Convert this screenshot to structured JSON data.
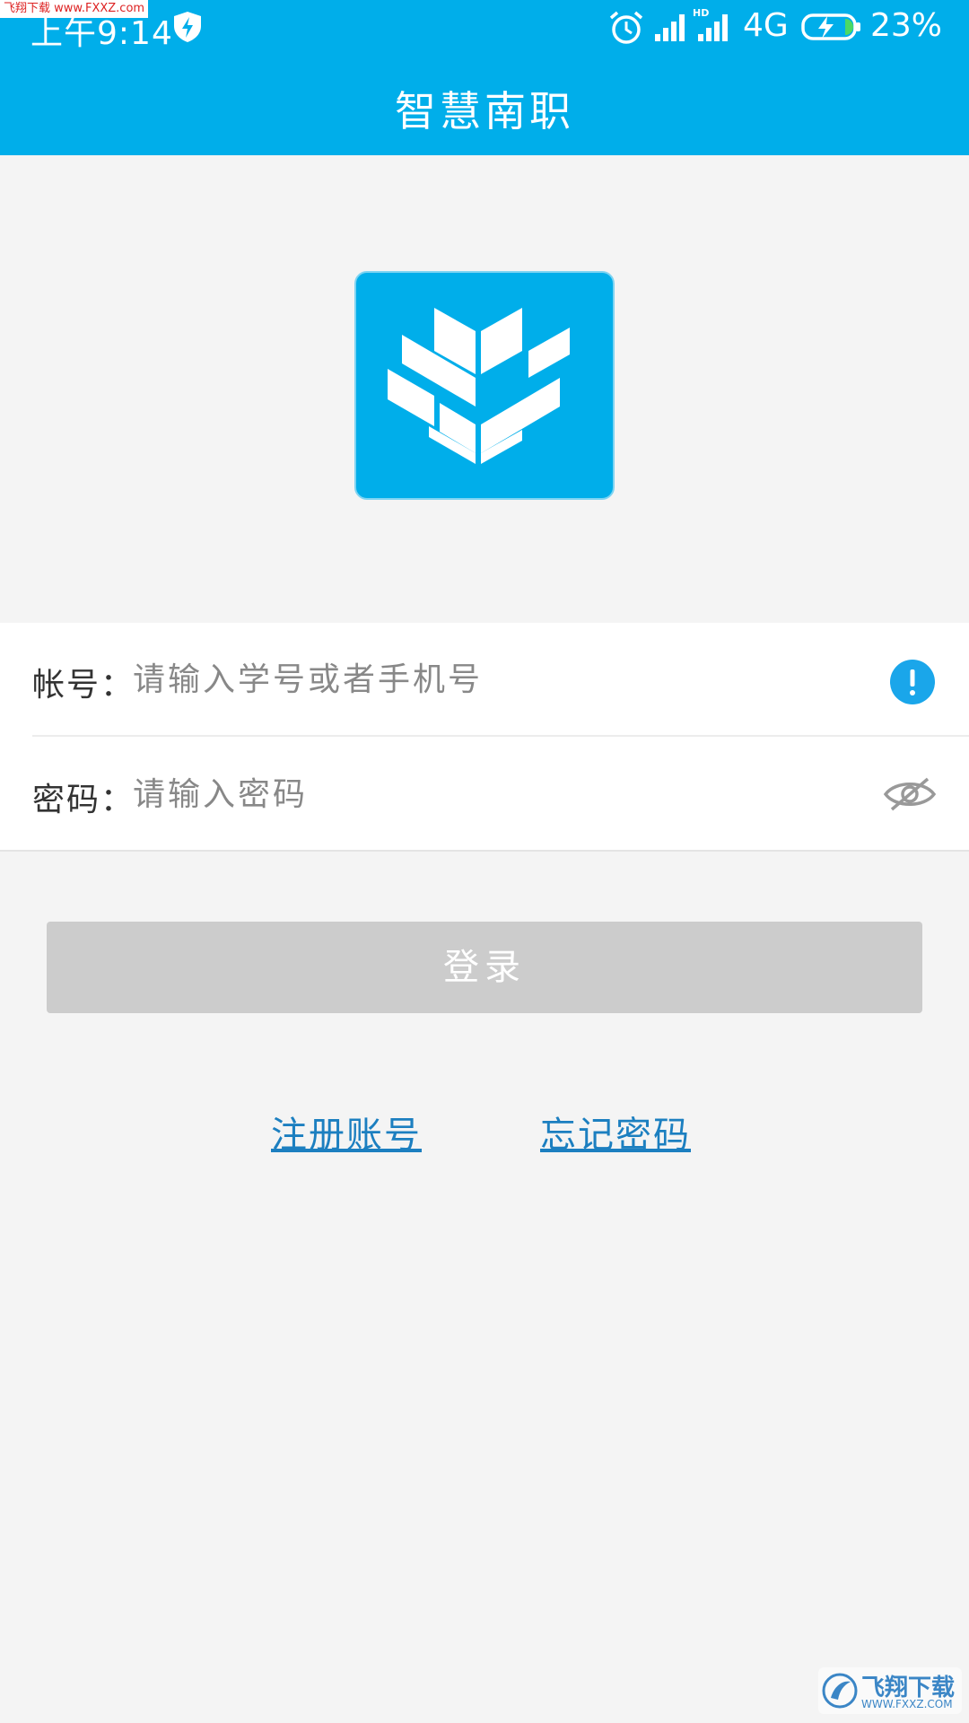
{
  "status_bar": {
    "time": "上午9:14",
    "network": "4G",
    "battery": "23%"
  },
  "watermark_top": "飞翔下载 www.FXXZ.com",
  "app": {
    "title": "智慧南职"
  },
  "form": {
    "account": {
      "label": "帐号：",
      "placeholder": "请输入学号或者手机号",
      "value": ""
    },
    "password": {
      "label": "密码：",
      "placeholder": "请输入密码",
      "value": ""
    }
  },
  "actions": {
    "login_label": "登录",
    "register_label": "注册账号",
    "forgot_label": "忘记密码"
  },
  "watermark_bottom": {
    "text": "飞翔下载",
    "url": "WWW.FXXZ.COM"
  },
  "colors": {
    "primary": "#00aeea",
    "link": "#1c7fc0",
    "button_disabled": "#cccccc",
    "background": "#f4f4f4",
    "info_badge": "#1aa6ea"
  }
}
